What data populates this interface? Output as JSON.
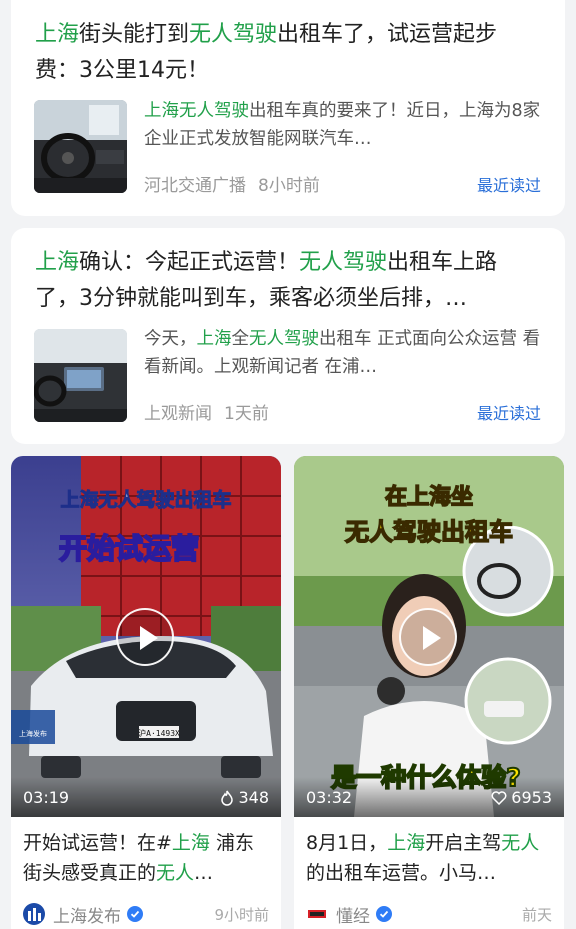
{
  "articles": [
    {
      "title_parts": [
        {
          "t": "上海",
          "hl": true
        },
        {
          "t": "街头能打到",
          "hl": false
        },
        {
          "t": "无人驾驶",
          "hl": true
        },
        {
          "t": "出租车了，试运营起步费：3公里14元！",
          "hl": false
        }
      ],
      "desc_parts": [
        {
          "t": "上海无人驾驶",
          "hl": true
        },
        {
          "t": "出租车真的要来了！近日，上海为8家企业正式发放智能网联汽车…",
          "hl": false
        }
      ],
      "source": "河北交通广播",
      "time": "8小时前",
      "recent_label": "最近读过"
    },
    {
      "title_parts": [
        {
          "t": "上海",
          "hl": true
        },
        {
          "t": "确认：今起正式运营！",
          "hl": false
        },
        {
          "t": "无人驾驶",
          "hl": true
        },
        {
          "t": "出租车上路了，3分钟就能叫到车，乘客必须坐后排，…",
          "hl": false
        }
      ],
      "desc_parts": [
        {
          "t": "今天，",
          "hl": false
        },
        {
          "t": "上海",
          "hl": true
        },
        {
          "t": "全",
          "hl": false
        },
        {
          "t": "无人驾驶",
          "hl": true
        },
        {
          "t": "出租车 正式面向公众运营 看看新闻。上观新闻记者 在浦…",
          "hl": false
        }
      ],
      "source": "上观新闻",
      "time": "1天前",
      "recent_label": "最近读过"
    }
  ],
  "videos": [
    {
      "overlay_line1": "上海无人驾驶出租车",
      "overlay_line2": "开始试运营",
      "plate": "沪A·1493X",
      "watermark": "上海发布",
      "duration": "03:19",
      "likes": "348",
      "title_parts": [
        {
          "t": "开始试运营！在#",
          "hl": false
        },
        {
          "t": "上海",
          "hl": true
        },
        {
          "t": " 浦东街头感受真正的",
          "hl": false
        },
        {
          "t": "无人",
          "hl": true
        },
        {
          "t": "…",
          "hl": false
        }
      ],
      "author": "上海发布",
      "time": "9小时前"
    },
    {
      "overlay_line1": "在上海坐",
      "overlay_line2": "无人驾驶出租车",
      "overlay_bottom": "是一种什么体验?",
      "duration": "03:32",
      "likes": "6953",
      "title_parts": [
        {
          "t": "8月1日，",
          "hl": false
        },
        {
          "t": "上海",
          "hl": true
        },
        {
          "t": "开启主驾",
          "hl": false
        },
        {
          "t": "无人",
          "hl": true
        },
        {
          "t": "的出租车运营。小马…",
          "hl": false
        }
      ],
      "author": "懂经",
      "time": "前天"
    }
  ],
  "colors": {
    "highlight": "#21a04a",
    "link": "#2a6fd8",
    "verified": "#2f7cf6"
  }
}
